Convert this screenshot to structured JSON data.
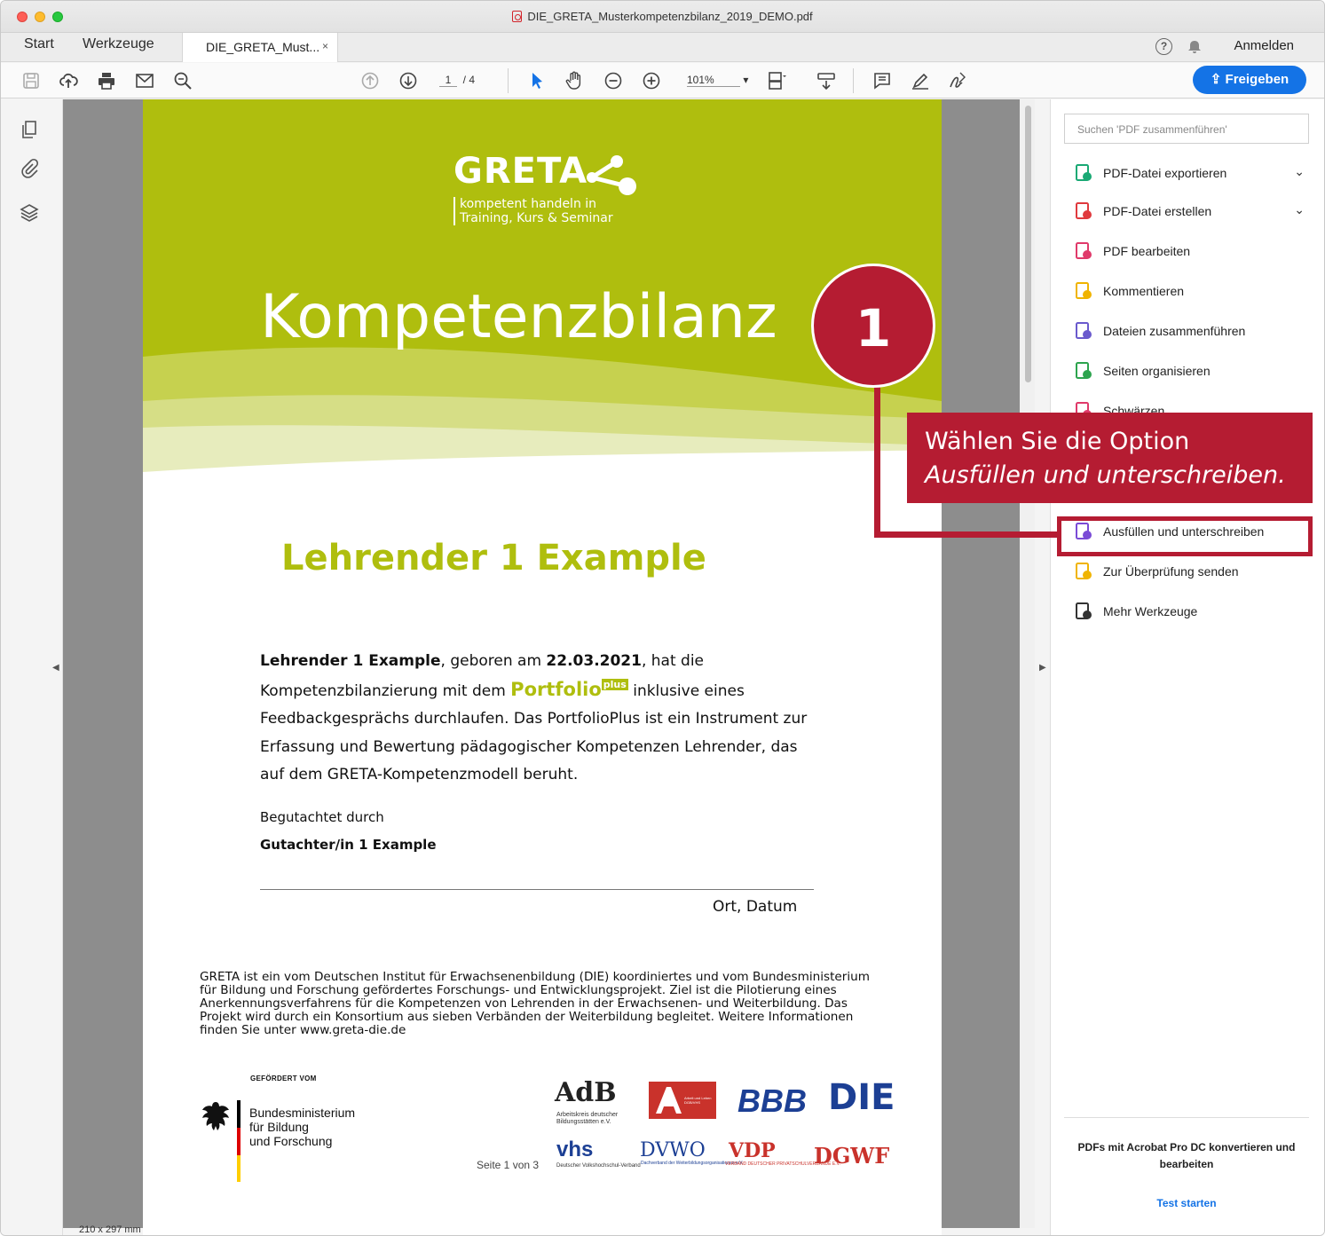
{
  "window": {
    "title": "DIE_GRETA_Musterkompetenzbilanz_2019_DEMO.pdf"
  },
  "tabs": {
    "start": "Start",
    "tools": "Werkzeuge",
    "doc": "DIE_GRETA_Must...",
    "close": "×",
    "help": "?",
    "signin": "Anmelden"
  },
  "toolbar": {
    "page_current": "1",
    "page_total": "/ 4",
    "zoom": "101%",
    "zoom_arrow": "▾",
    "share": "Freigeben",
    "icons": [
      "save-icon",
      "upload-icon",
      "print-icon",
      "mail-icon",
      "search-zoom-icon",
      "page-up-icon",
      "page-down-icon",
      "pointer-icon",
      "hand-icon",
      "zoom-out-icon",
      "zoom-in-icon",
      "fit-page-icon",
      "read-mode-icon",
      "comment-icon",
      "highlight-icon",
      "sign-icon"
    ]
  },
  "rail": {
    "collapse_left": "◀",
    "collapse_right": "▶",
    "page_size": "210 x 297 mm"
  },
  "document": {
    "brand": "GRETA",
    "brand_sub_1": "kompetent handeln in",
    "brand_sub_2": "Training, Kurs & Seminar",
    "title": "Kompetenzbilanz",
    "person": "Lehrender 1 Example",
    "para_name": "Lehrender 1 Example",
    "para_born": ", geboren am ",
    "para_date": "22.03.2021",
    "para_text1": ", hat die Kompetenzbilanzierung mit dem ",
    "portfolio": "Portfolio",
    "plus": "plus",
    "para_text2": " inklusive eines Feedbackgesprächs durchlaufen. Das PortfolioPlus ist ein Instrument zur Erfassung und Bewertung pädagogischer Kompetenzen Lehrender, das auf dem GRETA-Kompetenzmodell beruht.",
    "reviewed_by": "Begutachtet durch",
    "reviewer": "Gutachter/in 1 Example",
    "place_date": "Ort, Datum",
    "footnote": "GRETA ist ein vom Deutschen Institut für Erwachsenenbildung (DIE) koordiniertes und vom Bundesministerium für Bildung und Forschung gefördertes Forschungs- und Entwicklungsprojekt. Ziel ist die Pilotierung eines Anerkennungsverfahrens für die Kompetenzen von Lehrenden in der Erwachsenen- und Weiterbildung. Das Projekt wird durch ein Konsortium aus sieben Verbänden der Weiterbildung begleitet. Weitere Informationen finden Sie unter www.greta-die.de",
    "funded_by": "GEFÖRDERT VOM",
    "ministry_1": "Bundesministerium",
    "ministry_2": "für Bildung",
    "ministry_3": "und Forschung",
    "page_number": "Seite 1 von 3",
    "logos": {
      "adb": "AdB",
      "adb_sub": "Arbeitskreis deutscher Bildungsstätten e.V.",
      "ka": "Arbeit und Leben DGB/VHS",
      "bbb": "BBB",
      "die": "DIE",
      "vhs": "vhs",
      "vhs_sub": "Deutscher Volkshochschul-Verband",
      "dvwo": "DVWO",
      "dvwo_sub": "Dachverband der Weiterbildungsorganisationen e.V.",
      "vdp": "VDP",
      "vdp_sub": "VERBAND DEUTSCHER PRIVATSCHULVERBÄNDE E.V.",
      "dgwf": "DGWF"
    }
  },
  "right_panel": {
    "search_placeholder": "Suchen 'PDF zusammenführen'",
    "tools": [
      {
        "label": "PDF-Datei exportieren",
        "icon": "export-pdf-icon",
        "color": "#19a974"
      },
      {
        "label": "PDF-Datei erstellen",
        "icon": "create-pdf-icon",
        "color": "#e03a3e"
      },
      {
        "label": "PDF bearbeiten",
        "icon": "edit-pdf-icon",
        "color": "#e03a6a"
      },
      {
        "label": "Kommentieren",
        "icon": "comment-tool-icon",
        "color": "#f0b400"
      },
      {
        "label": "Dateien zusammenführen",
        "icon": "combine-files-icon",
        "color": "#6a5acd"
      },
      {
        "label": "Seiten organisieren",
        "icon": "organize-pages-icon",
        "color": "#2da44e"
      },
      {
        "label": "Schwärzen",
        "icon": "redact-icon",
        "color": "#e03a6a"
      },
      {
        "label": "Ausfüllen und unterschreiben",
        "icon": "fill-sign-icon",
        "color": "#7a4bd6"
      },
      {
        "label": "Zur Überprüfung senden",
        "icon": "send-review-icon",
        "color": "#f0b400"
      },
      {
        "label": "Mehr Werkzeuge",
        "icon": "more-tools-icon",
        "color": "#333333"
      }
    ],
    "chevron": "⌄",
    "promo": "PDFs mit Acrobat Pro DC konvertieren und bearbeiten",
    "trial": "Test starten"
  },
  "annotation": {
    "step": "1",
    "line1": "Wählen Sie die Option",
    "line2": "Ausfüllen und unterschreiben.",
    "color": "#b51c32"
  }
}
